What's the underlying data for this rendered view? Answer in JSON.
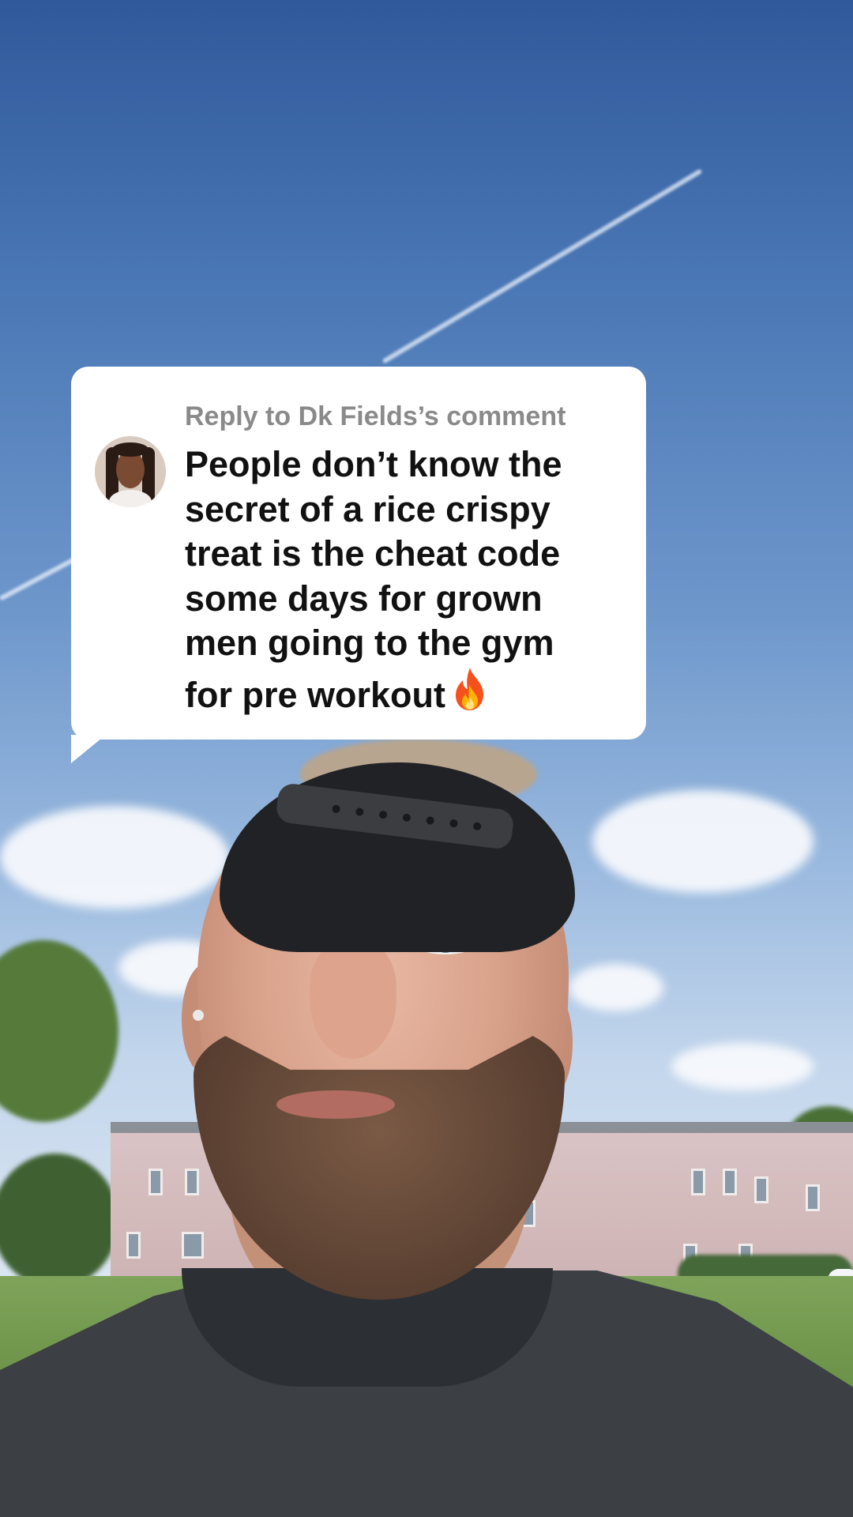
{
  "reply_sticker": {
    "header": "Reply to Dk Fields’s comment",
    "comment_lines": [
      "People don’t know the",
      "secret of a rice crispy",
      "treat is the cheat code",
      "some days for grown",
      "men going to the gym",
      "for pre workout"
    ],
    "emoji_icon": "fire-icon",
    "avatar_icon": "commenter-avatar"
  },
  "colors": {
    "sticker_bg": "#ffffff",
    "header_text": "#8a8a8a",
    "comment_text": "#111111"
  }
}
